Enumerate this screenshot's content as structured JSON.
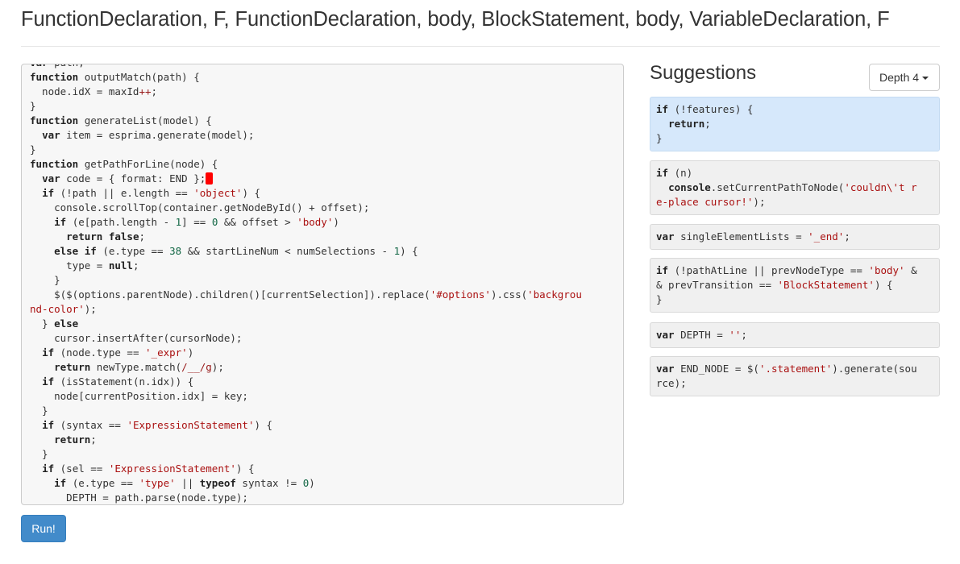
{
  "title": "FunctionDeclaration, F, FunctionDeclaration, body, BlockStatement, body, VariableDeclaration, F",
  "run_label": "Run!",
  "suggestions_heading": "Suggestions",
  "depth_label": "Depth 4",
  "colors": {
    "accent": "#428bca",
    "selected_suggestion": "#d6e8fb",
    "suggestion_bg": "#f0f0f0",
    "cursor_marker": "#ff0000",
    "string": "#aa1111",
    "number": "#116644"
  },
  "editor_lines": [
    [
      [
        "kw",
        "var"
      ],
      [
        "t",
        " path;"
      ]
    ],
    [
      [
        "kw",
        "function"
      ],
      [
        "t",
        " outputMatch(path) {"
      ]
    ],
    [
      [
        "t",
        "  node.idX = maxId"
      ],
      [
        "op",
        "++"
      ],
      [
        "t",
        ";"
      ]
    ],
    [
      [
        "t",
        "}"
      ]
    ],
    [
      [
        "kw",
        "function"
      ],
      [
        "t",
        " generateList(model) {"
      ]
    ],
    [
      [
        "t",
        "  "
      ],
      [
        "kw",
        "var"
      ],
      [
        "t",
        " item = esprima.generate(model);"
      ]
    ],
    [
      [
        "t",
        "}"
      ]
    ],
    [
      [
        "kw",
        "function"
      ],
      [
        "t",
        " getPathForLine(node) {"
      ]
    ],
    [
      [
        "t",
        "  "
      ],
      [
        "kw",
        "var"
      ],
      [
        "t",
        " code = { format: END };"
      ],
      [
        "cursor",
        ""
      ]
    ],
    [
      [
        "t",
        "  "
      ],
      [
        "kw",
        "if"
      ],
      [
        "t",
        " (!path || e.length == "
      ],
      [
        "str",
        "'object'"
      ],
      [
        "t",
        ") {"
      ]
    ],
    [
      [
        "t",
        "    console.scrollTop(container.getNodeById() + offset);"
      ]
    ],
    [
      [
        "t",
        "    "
      ],
      [
        "kw",
        "if"
      ],
      [
        "t",
        " (e[path.length - "
      ],
      [
        "num",
        "1"
      ],
      [
        "t",
        "] == "
      ],
      [
        "num",
        "0"
      ],
      [
        "t",
        " && offset > "
      ],
      [
        "str",
        "'body'"
      ],
      [
        "t",
        ")"
      ]
    ],
    [
      [
        "t",
        "      "
      ],
      [
        "kw",
        "return false"
      ],
      [
        "t",
        ";"
      ]
    ],
    [
      [
        "t",
        "    "
      ],
      [
        "kw",
        "else if"
      ],
      [
        "t",
        " (e.type == "
      ],
      [
        "num",
        "38"
      ],
      [
        "t",
        " && startLineNum < numSelections - "
      ],
      [
        "num",
        "1"
      ],
      [
        "t",
        ") {"
      ]
    ],
    [
      [
        "t",
        "      type = "
      ],
      [
        "kw",
        "null"
      ],
      [
        "t",
        ";"
      ]
    ],
    [
      [
        "t",
        "    }"
      ]
    ],
    [
      [
        "t",
        "    $($(options.parentNode).children()[currentSelection]).replace("
      ],
      [
        "str",
        "'#options'"
      ],
      [
        "t",
        ").css("
      ],
      [
        "str",
        "'backgrou"
      ]
    ],
    [
      [
        "str",
        "nd-color'"
      ],
      [
        "t",
        ");"
      ]
    ],
    [
      [
        "t",
        "  } "
      ],
      [
        "kw",
        "else"
      ]
    ],
    [
      [
        "t",
        "    cursor.insertAfter(cursorNode);"
      ]
    ],
    [
      [
        "t",
        "  "
      ],
      [
        "kw",
        "if"
      ],
      [
        "t",
        " (node.type == "
      ],
      [
        "str",
        "'_expr'"
      ],
      [
        "t",
        ")"
      ]
    ],
    [
      [
        "t",
        "    "
      ],
      [
        "kw",
        "return"
      ],
      [
        "t",
        " newType.match("
      ],
      [
        "op",
        "/__/g"
      ],
      [
        "t",
        ");"
      ]
    ],
    [
      [
        "t",
        "  "
      ],
      [
        "kw",
        "if"
      ],
      [
        "t",
        " (isStatement(n.idx)) {"
      ]
    ],
    [
      [
        "t",
        "    node[currentPosition.idx] = key;"
      ]
    ],
    [
      [
        "t",
        "  }"
      ]
    ],
    [
      [
        "t",
        "  "
      ],
      [
        "kw",
        "if"
      ],
      [
        "t",
        " (syntax == "
      ],
      [
        "str",
        "'ExpressionStatement'"
      ],
      [
        "t",
        ") {"
      ]
    ],
    [
      [
        "t",
        "    "
      ],
      [
        "kw",
        "return"
      ],
      [
        "t",
        ";"
      ]
    ],
    [
      [
        "t",
        "  }"
      ]
    ],
    [
      [
        "t",
        "  "
      ],
      [
        "kw",
        "if"
      ],
      [
        "t",
        " (sel == "
      ],
      [
        "str",
        "'ExpressionStatement'"
      ],
      [
        "t",
        ") {"
      ]
    ],
    [
      [
        "t",
        "    "
      ],
      [
        "kw",
        "if"
      ],
      [
        "t",
        " (e.type == "
      ],
      [
        "str",
        "'type'"
      ],
      [
        "t",
        " || "
      ],
      [
        "kw",
        "typeof"
      ],
      [
        "t",
        " syntax != "
      ],
      [
        "num",
        "0"
      ],
      [
        "t",
        ")"
      ]
    ],
    [
      [
        "t",
        "      DEPTH = path.parse(node.type);"
      ]
    ]
  ],
  "suggestions": [
    {
      "selected": true,
      "lines": [
        [
          [
            "kw",
            "if"
          ],
          [
            "t",
            " (!features) {"
          ]
        ],
        [
          [
            "t",
            "  "
          ],
          [
            "kw",
            "return"
          ],
          [
            "t",
            ";"
          ]
        ],
        [
          [
            "t",
            "}"
          ]
        ]
      ]
    },
    {
      "selected": false,
      "lines": [
        [
          [
            "kw",
            "if"
          ],
          [
            "t",
            " (n)"
          ]
        ],
        [
          [
            "t",
            "  "
          ],
          [
            "kw",
            "console"
          ],
          [
            "t",
            ".setCurrentPathToNode("
          ],
          [
            "str",
            "'couldn\\'t r"
          ]
        ],
        [
          [
            "str",
            "e-place cursor!'"
          ],
          [
            "t",
            ");"
          ]
        ]
      ]
    },
    {
      "selected": false,
      "lines": [
        [
          [
            "kw",
            "var"
          ],
          [
            "t",
            " singleElementLists = "
          ],
          [
            "str",
            "'_end'"
          ],
          [
            "t",
            ";"
          ]
        ]
      ]
    },
    {
      "selected": false,
      "lines": [
        [
          [
            "kw",
            "if"
          ],
          [
            "t",
            " (!pathAtLine || prevNodeType == "
          ],
          [
            "str",
            "'body'"
          ],
          [
            "t",
            " &"
          ]
        ],
        [
          [
            "t",
            "& prevTransition == "
          ],
          [
            "str",
            "'BlockStatement'"
          ],
          [
            "t",
            ") {"
          ]
        ],
        [
          [
            "t",
            "}"
          ]
        ]
      ]
    },
    {
      "selected": false,
      "lines": [
        [
          [
            "kw",
            "var"
          ],
          [
            "t",
            " DEPTH = "
          ],
          [
            "str",
            "''"
          ],
          [
            "t",
            ";"
          ]
        ]
      ]
    },
    {
      "selected": false,
      "lines": [
        [
          [
            "kw",
            "var"
          ],
          [
            "t",
            " END_NODE = $("
          ],
          [
            "str",
            "'.statement'"
          ],
          [
            "t",
            ").generate(sou"
          ]
        ],
        [
          [
            "t",
            "rce);"
          ]
        ]
      ]
    }
  ]
}
